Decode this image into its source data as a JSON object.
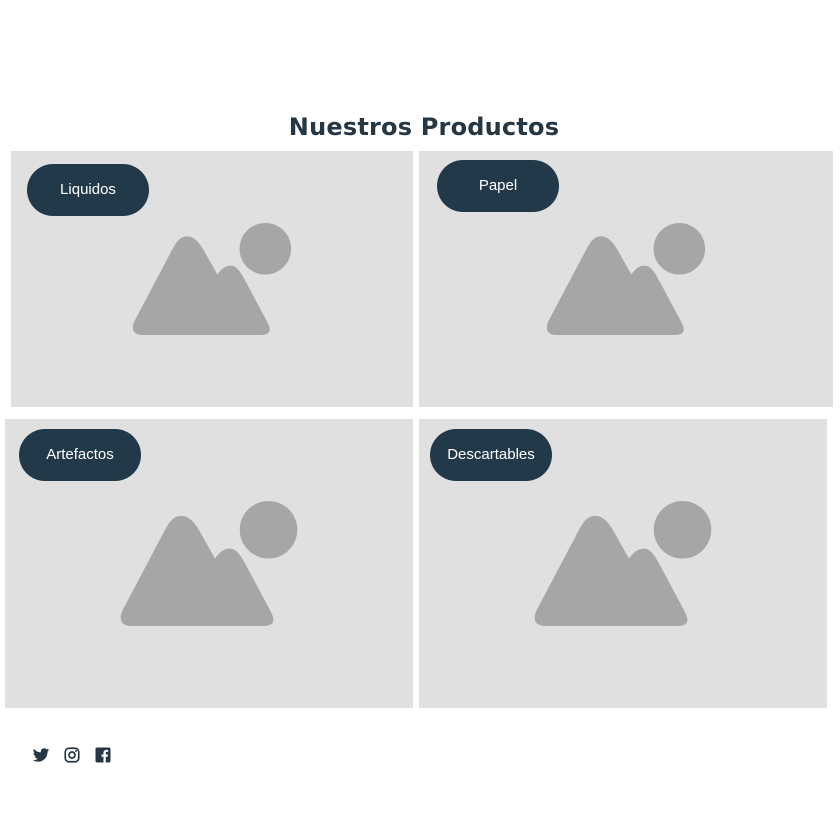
{
  "page": {
    "title": "Nuestros Productos"
  },
  "products": [
    {
      "label": "Liquidos"
    },
    {
      "label": "Papel"
    },
    {
      "label": "Artefactos"
    },
    {
      "label": "Descartables"
    }
  ],
  "social": {
    "icons": [
      "twitter-icon",
      "instagram-icon",
      "facebook-icon"
    ]
  },
  "colors": {
    "heading": "#253645",
    "pill": "#223949",
    "card_bg": "#e0e0e1",
    "placeholder": "#a6a6a6",
    "icon": "#253645"
  }
}
